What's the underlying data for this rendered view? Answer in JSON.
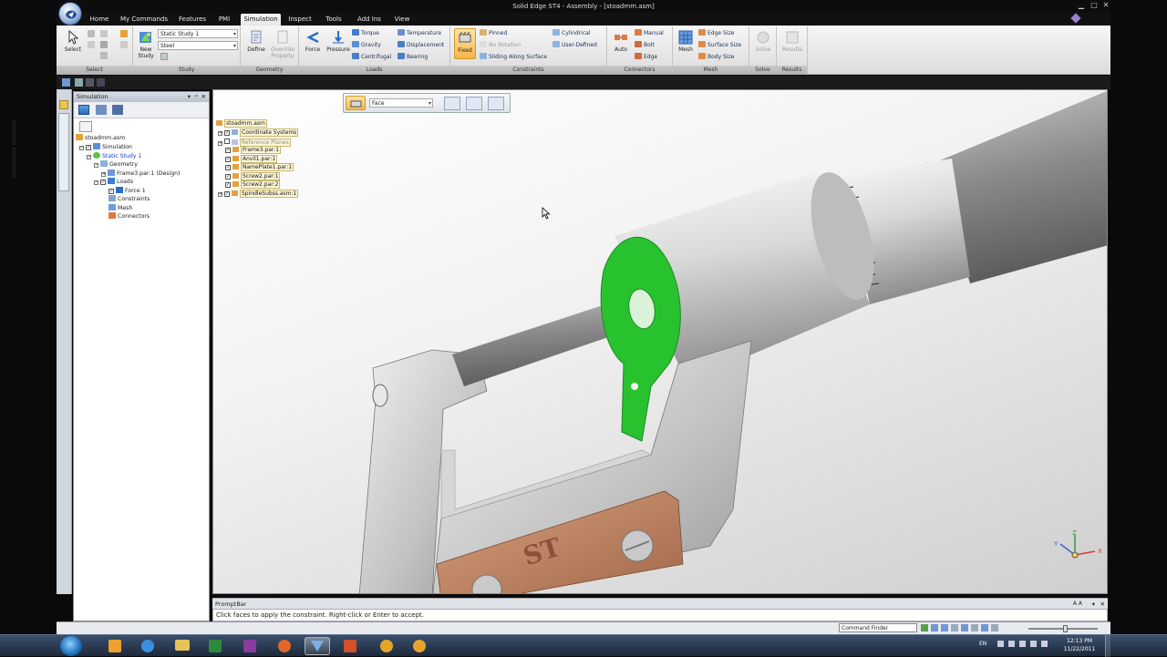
{
  "window": {
    "title": "Solid Edge ST4 - Assembly - [stoadmm.asm]"
  },
  "tabs": [
    "Home",
    "My Commands",
    "Features",
    "PMI",
    "Simulation",
    "Inspect",
    "Tools",
    "Add Ins",
    "View"
  ],
  "active_tab": "Simulation",
  "ribbon": {
    "select": {
      "label": "Select",
      "group": "Select"
    },
    "study": {
      "study_value": "Static Study 1",
      "material_value": "Steel",
      "new_study": "New\nStudy",
      "group": "Study"
    },
    "geometry": {
      "define": "Define",
      "override": "Override\nProperty",
      "group": "Geometry"
    },
    "loads": {
      "force": "Force",
      "pressure": "Pressure",
      "torque": "Torque",
      "gravity": "Gravity",
      "centrifugal": "Centrifugal",
      "temperature": "Temperature",
      "displacement": "Displacement",
      "bearing": "Bearing",
      "group": "Loads"
    },
    "constraints": {
      "fixed": "Fixed",
      "pinned": "Pinned",
      "no_rotation": "No Rotation",
      "sliding": "Sliding Along Surface",
      "cylindrical": "Cylindrical",
      "user_defined": "User-Defined",
      "group": "Constraints"
    },
    "connectors": {
      "auto": "Auto",
      "manual": "Manual",
      "bolt": "Bolt",
      "edge": "Edge",
      "group": "Connectors"
    },
    "mesh": {
      "mesh": "Mesh",
      "edge_size": "Edge Size",
      "surface_size": "Surface Size",
      "body_size": "Body Size",
      "group": "Mesh"
    },
    "solve": {
      "solve": "Solve",
      "group": "Solve"
    },
    "results": {
      "results": "Results",
      "group": "Results"
    }
  },
  "sidebar": {
    "alt_tab": "Alternate Assemblies"
  },
  "sim_pane": {
    "title": "Simulation",
    "tree": [
      {
        "label": "stoadmm.asm"
      },
      {
        "label": "Simulation"
      },
      {
        "label": "Static Study 1"
      },
      {
        "label": "Geometry"
      },
      {
        "label": "Frame3.par:1 (Design)"
      },
      {
        "label": "Loads"
      },
      {
        "label": "Force 1"
      },
      {
        "label": "Constraints"
      },
      {
        "label": "Mesh"
      },
      {
        "label": "Connectors"
      }
    ]
  },
  "command_bar": {
    "select_value": "Face"
  },
  "part_tree": {
    "root": "stoadmm.asm",
    "items": [
      "Coordinate Systems",
      "Reference Planes",
      "Frame3.par:1",
      "Anvil1.par:1",
      "NamePlate1.par:1",
      "Screw2.par:1",
      "Screw2.par:2",
      "SpindleSubss.asm:1"
    ]
  },
  "prompt": {
    "header": "PromptBar",
    "text": "Click faces to apply the constraint.  Right-click or Enter to accept."
  },
  "status": {
    "command_finder": "Command Finder"
  },
  "taskbar": {
    "lang": "EN",
    "time": "12:13 PM",
    "date": "11/22/2011"
  },
  "viewport": {
    "plate_text": "ST",
    "axes": {
      "x": "X",
      "y": "Y",
      "z": "Z"
    }
  }
}
